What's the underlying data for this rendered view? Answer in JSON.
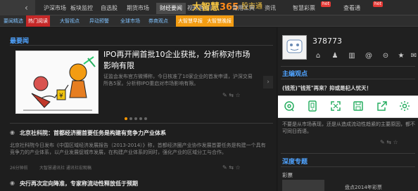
{
  "topbar": {
    "back_icon": "‹",
    "nav": [
      "沪深市场",
      "板块监控",
      "自选股",
      "期货市场",
      "财经要闻",
      "视频直播间",
      "常用工具",
      "资讯",
      "智慧彩票",
      "查看通"
    ],
    "active_nav_index": 4,
    "brand": "大智慧",
    "brand_num": "365",
    "brand_suffix": "股市通",
    "hot_badges": [
      "hot",
      "hot"
    ]
  },
  "subbar": {
    "tabs": [
      {
        "label": "要闻精选",
        "style": "normal"
      },
      {
        "label": "热门阅读",
        "style": "red"
      },
      {
        "label": "大智视点",
        "style": "normal"
      },
      {
        "label": "异动预警",
        "style": "normal"
      },
      {
        "label": "全球市场",
        "style": "normal"
      },
      {
        "label": "券商观点",
        "style": "normal"
      },
      {
        "label": "大智慧早报",
        "style": "orange"
      },
      {
        "label": "大智慧晚报",
        "style": "orange"
      }
    ]
  },
  "main": {
    "section_title": "最要闻",
    "featured": {
      "headline": "IPO再开闸首批10企业获批，分析称对市场影响有限",
      "summary": "证监会发布官方微博称，今日核准了10家企业的首发申请，沪深交易所各5家。分析称IPO重启对市场影响有限。",
      "image_icon": "ipo-cartoon"
    },
    "carousel_dots": 5,
    "active_dot": 0,
    "news": [
      {
        "title": "北京社科院：首都经济圈首要任务是构建有竞争力产业体系",
        "body": "北京社科院今日发布《中国区域经济发展报告（2013-2014）》称，首都经济圈产业协作发展首要任务是构建一个具有竞争力的产业体系，以产业发展促城市发展，在构建产业体系的同时，强化产业的区域分工与合作。",
        "time": "26分钟前",
        "source": "大智慧通讯社 通讯社宏观稿"
      },
      {
        "title": "央行再次定向降准，专家称流动性释放低于预期",
        "body": "",
        "time": "",
        "source": ""
      }
    ]
  },
  "sidebar": {
    "user_id": "378773",
    "section1_title": "主编观点",
    "opinion_title": "(钱荒)\"钱荒\"再来？抑或是杞人忧天！",
    "opinion_body": "不要是从市场表现，还是从造成流动性趋紧的主要原因，都不可同日而语。",
    "section2_title": "深度专题",
    "topic_label": "彩票",
    "topic_item": "盘点2014年彩票",
    "icons": [
      "home-icon",
      "user-icon",
      "chart-icon",
      "at-icon",
      "message-icon",
      "star-icon",
      "mail-icon"
    ]
  },
  "share_bar": {
    "icons": [
      "weibo-icon",
      "tablet-icon",
      "fullscreen-icon",
      "save-icon",
      "share-icon",
      "settings-icon"
    ]
  },
  "colors": {
    "accent": "#4fa3ff",
    "brand": "#f5c542",
    "hot": "#e53935",
    "share_icon": "#27ae60"
  }
}
